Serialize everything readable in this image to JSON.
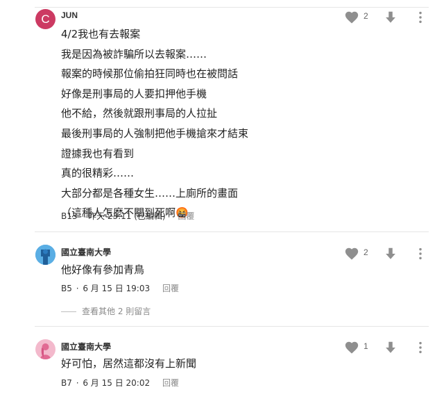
{
  "colors": {
    "accent_avatar": "#cc3a62",
    "icon_gray": "#8f8f8f",
    "reply_gray": "#8a8a8a",
    "divider": "#e6e6e6"
  },
  "comments": [
    {
      "avatar": {
        "type": "letter",
        "letter": "C"
      },
      "author": "JUN",
      "likes": "2",
      "lines": [
        "4/2我也有去報案",
        "我是因為被詐騙所以去報案……",
        "報案的時候那位偷拍狂同時也在被問話",
        "好像是刑事局的人要扣押他手機",
        "他不給，然後就跟刑事局的人拉扯",
        "最後刑事局的人強制把他手機搶來才結束",
        "證據我也有看到",
        "真的很精彩……",
        "大部分都是各種女生……上廁所的畫面",
        "（這種人怎麼不關到死啊🤬"
      ],
      "floor": "B13",
      "time": "昨天 23:11 (已編輯)",
      "reply_label": "回覆"
    },
    {
      "avatar": {
        "type": "icon",
        "icon": "blue-person-icon"
      },
      "author": "國立臺南大學",
      "likes": "2",
      "lines": [
        "他好像有參加青鳥"
      ],
      "floor": "B5",
      "time": "6 月 15 日 19:03",
      "reply_label": "回覆"
    },
    {
      "avatar": {
        "type": "icon",
        "icon": "pink-person-icon"
      },
      "author": "國立臺南大學",
      "likes": "1",
      "lines": [
        "好可怕，居然這都沒有上新聞"
      ],
      "floor": "B7",
      "time": "6 月 15 日 20:02",
      "reply_label": "回覆"
    }
  ],
  "view_more_replies": "查看其他 2 則留言",
  "meta_separator": "·"
}
